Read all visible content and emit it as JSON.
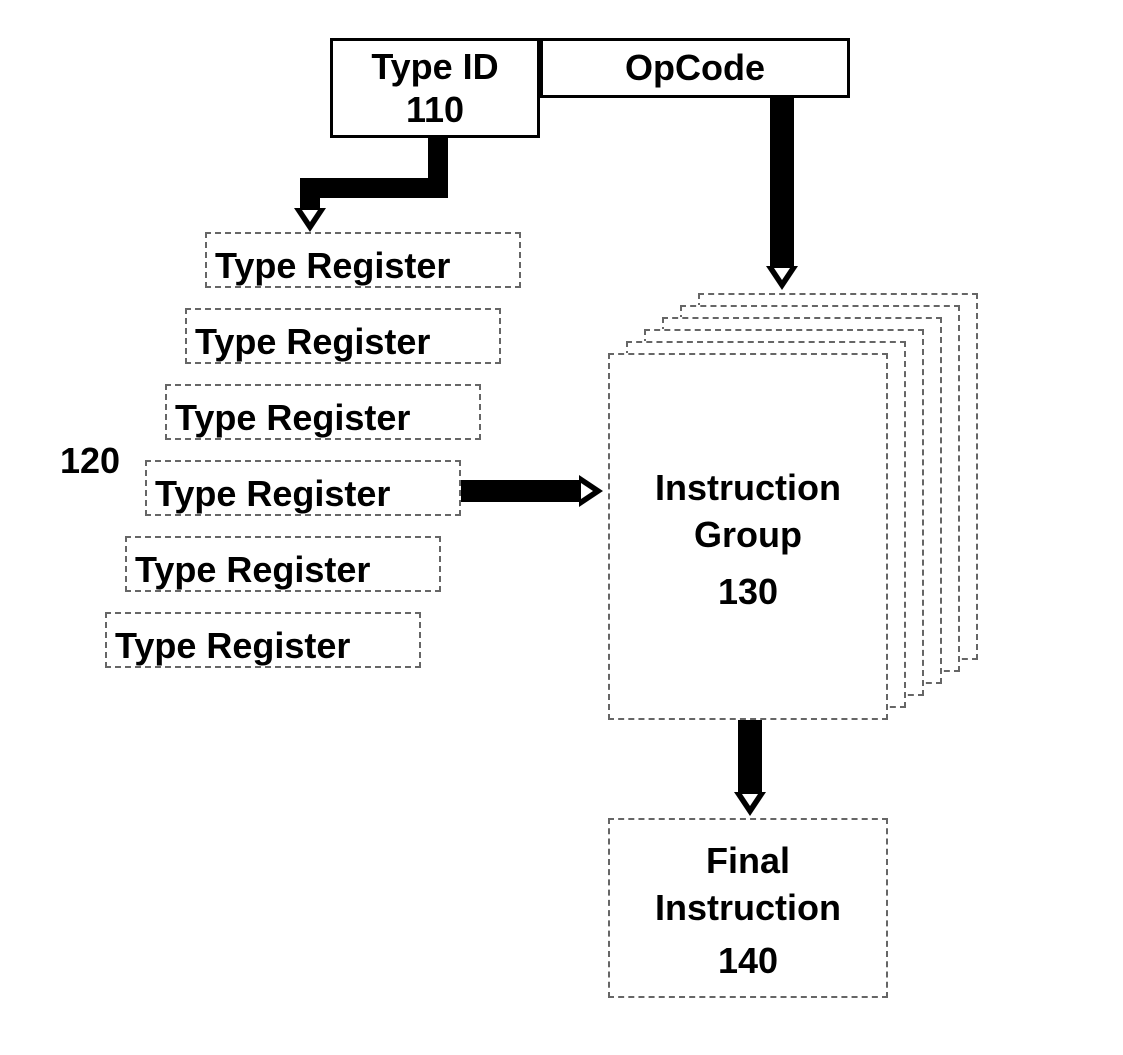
{
  "top": {
    "typeid_label": "Type ID",
    "typeid_num": "110",
    "opcode_label": "OpCode"
  },
  "registers_label": "120",
  "registers": [
    "Type Register",
    "Type Register",
    "Type Register",
    "Type Register",
    "Type Register",
    "Type Register"
  ],
  "group": {
    "title": "Instruction Group",
    "num": "130"
  },
  "final": {
    "title": "Final Instruction",
    "num": "140"
  }
}
